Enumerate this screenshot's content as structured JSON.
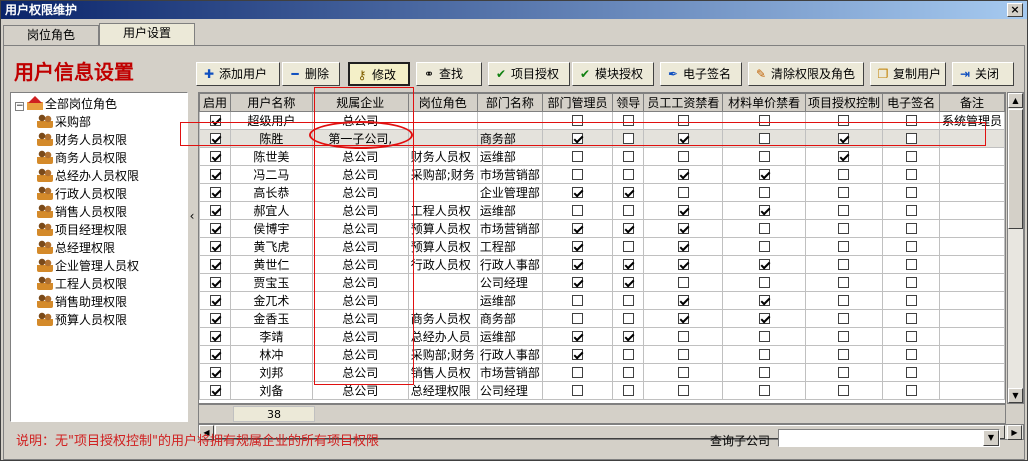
{
  "window": {
    "title": "用户权限维护",
    "close_glyph": "×"
  },
  "tabs": [
    {
      "label": "岗位角色"
    },
    {
      "label": "用户设置"
    }
  ],
  "page_title": "用户信息设置",
  "toolbar": {
    "add": "添加用户",
    "delete": "删除",
    "edit": "修改",
    "find": "查找",
    "project_auth": "项目授权",
    "module_auth": "模块授权",
    "esign": "电子签名",
    "clear": "清除权限及角色",
    "copy": "复制用户",
    "close": "关闭"
  },
  "tree": {
    "root": "全部岗位角色",
    "items": [
      "采购部",
      "财务人员权限",
      "商务人员权限",
      "总经办人员权限",
      "行政人员权限",
      "销售人员权限",
      "项目经理权限",
      "总经理权限",
      "企业管理人员权",
      "工程人员权限",
      "销售助理权限",
      "预算人员权限"
    ]
  },
  "grid": {
    "columns": [
      "启用",
      "用户名称",
      "规属企业",
      "岗位角色",
      "部门名称",
      "部门管理员",
      "领导",
      "员工工资禁看",
      "材料单价禁看",
      "项目授权控制",
      "电子签名",
      "备注"
    ],
    "rows": [
      {
        "enabled": true,
        "name": "超级用户",
        "company": "总公司",
        "role": "",
        "dept": "",
        "dept_admin": false,
        "leader": false,
        "salary_hide": false,
        "price_hide": false,
        "proj_ctrl": false,
        "esign": false,
        "note": "系统管理员"
      },
      {
        "enabled": true,
        "name": "陈胜",
        "company": "第一子公司,",
        "role": "",
        "dept": "商务部",
        "dept_admin": true,
        "leader": false,
        "salary_hide": true,
        "price_hide": false,
        "proj_ctrl": true,
        "esign": false,
        "note": ""
      },
      {
        "enabled": true,
        "name": "陈世美",
        "company": "总公司",
        "role": "财务人员权",
        "dept": "运维部",
        "dept_admin": false,
        "leader": false,
        "salary_hide": false,
        "price_hide": false,
        "proj_ctrl": true,
        "esign": false,
        "note": ""
      },
      {
        "enabled": true,
        "name": "冯二马",
        "company": "总公司",
        "role": "采购部;财务",
        "dept": "市场营销部",
        "dept_admin": false,
        "leader": false,
        "salary_hide": true,
        "price_hide": true,
        "proj_ctrl": false,
        "esign": false,
        "note": ""
      },
      {
        "enabled": true,
        "name": "高长恭",
        "company": "总公司",
        "role": "",
        "dept": "企业管理部",
        "dept_admin": true,
        "leader": true,
        "salary_hide": false,
        "price_hide": false,
        "proj_ctrl": false,
        "esign": false,
        "note": ""
      },
      {
        "enabled": true,
        "name": "郝宜人",
        "company": "总公司",
        "role": "工程人员权",
        "dept": "运维部",
        "dept_admin": false,
        "leader": false,
        "salary_hide": true,
        "price_hide": true,
        "proj_ctrl": false,
        "esign": false,
        "note": ""
      },
      {
        "enabled": true,
        "name": "侯博宇",
        "company": "总公司",
        "role": "预算人员权",
        "dept": "市场营销部",
        "dept_admin": true,
        "leader": true,
        "salary_hide": true,
        "price_hide": false,
        "proj_ctrl": false,
        "esign": false,
        "note": ""
      },
      {
        "enabled": true,
        "name": "黄飞虎",
        "company": "总公司",
        "role": "预算人员权",
        "dept": "工程部",
        "dept_admin": true,
        "leader": false,
        "salary_hide": true,
        "price_hide": false,
        "proj_ctrl": false,
        "esign": false,
        "note": ""
      },
      {
        "enabled": true,
        "name": "黄世仁",
        "company": "总公司",
        "role": "行政人员权",
        "dept": "行政人事部",
        "dept_admin": true,
        "leader": true,
        "salary_hide": true,
        "price_hide": true,
        "proj_ctrl": false,
        "esign": false,
        "note": ""
      },
      {
        "enabled": true,
        "name": "贾宝玉",
        "company": "总公司",
        "role": "",
        "dept": "公司经理",
        "dept_admin": true,
        "leader": true,
        "salary_hide": false,
        "price_hide": false,
        "proj_ctrl": false,
        "esign": false,
        "note": ""
      },
      {
        "enabled": true,
        "name": "金兀术",
        "company": "总公司",
        "role": "",
        "dept": "运维部",
        "dept_admin": false,
        "leader": false,
        "salary_hide": true,
        "price_hide": true,
        "proj_ctrl": false,
        "esign": false,
        "note": ""
      },
      {
        "enabled": true,
        "name": "金香玉",
        "company": "总公司",
        "role": "商务人员权",
        "dept": "商务部",
        "dept_admin": false,
        "leader": false,
        "salary_hide": true,
        "price_hide": true,
        "proj_ctrl": false,
        "esign": false,
        "note": ""
      },
      {
        "enabled": true,
        "name": "李靖",
        "company": "总公司",
        "role": "总经办人员",
        "dept": "运维部",
        "dept_admin": true,
        "leader": true,
        "salary_hide": false,
        "price_hide": false,
        "proj_ctrl": false,
        "esign": false,
        "note": ""
      },
      {
        "enabled": true,
        "name": "林冲",
        "company": "总公司",
        "role": "采购部;财务",
        "dept": "行政人事部",
        "dept_admin": true,
        "leader": false,
        "salary_hide": false,
        "price_hide": false,
        "proj_ctrl": false,
        "esign": false,
        "note": ""
      },
      {
        "enabled": true,
        "name": "刘邦",
        "company": "总公司",
        "role": "销售人员权",
        "dept": "市场营销部",
        "dept_admin": false,
        "leader": false,
        "salary_hide": false,
        "price_hide": false,
        "proj_ctrl": false,
        "esign": false,
        "note": ""
      },
      {
        "enabled": true,
        "name": "刘备",
        "company": "总公司",
        "role": "总经理权限",
        "dept": "公司经理",
        "dept_admin": false,
        "leader": false,
        "salary_hide": false,
        "price_hide": false,
        "proj_ctrl": false,
        "esign": false,
        "note": ""
      }
    ],
    "count": "38"
  },
  "note": "说明：无\"项目授权控制\"的用户将拥有规属企业的所有项目权限",
  "subcompany": {
    "label": "查询子公司",
    "value": ""
  },
  "colors": {
    "accent_red": "#e01010",
    "title_red": "#c00000"
  }
}
